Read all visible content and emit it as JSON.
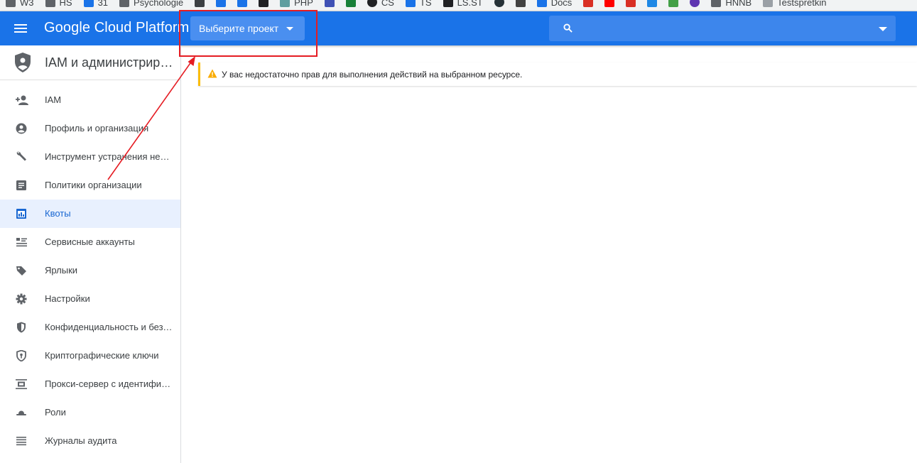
{
  "bookmarks": [
    {
      "label": "W3",
      "icon": "folder-icon",
      "color": "#5f6368"
    },
    {
      "label": "HS",
      "icon": "folder-icon",
      "color": "#5f6368"
    },
    {
      "label": "31",
      "icon": "calendar-icon",
      "color": "#1a73e8"
    },
    {
      "label": "Psychologie",
      "icon": "folder-icon",
      "color": "#5f6368"
    },
    {
      "label": "",
      "icon": "bookmark-icon",
      "color": "#3c4043"
    },
    {
      "label": "",
      "icon": "bookmark-icon",
      "color": "#1a73e8"
    },
    {
      "label": "",
      "icon": "bookmark-icon",
      "color": "#1a73e8"
    },
    {
      "label": "",
      "icon": "bookmark-icon",
      "color": "#202124"
    },
    {
      "label": "PHP",
      "icon": "bookmark-icon",
      "color": "#5f9ea0"
    },
    {
      "label": "",
      "icon": "bookmark-icon",
      "color": "#3f51b5"
    },
    {
      "label": "",
      "icon": "bookmark-icon",
      "color": "#188038"
    },
    {
      "label": "CS",
      "icon": "github-icon",
      "color": "#202124"
    },
    {
      "label": "TS",
      "icon": "bookmark-icon",
      "color": "#1a73e8"
    },
    {
      "label": "LS.ST",
      "icon": "bookmark-icon",
      "color": "#202124"
    },
    {
      "label": "",
      "icon": "bookmark-icon",
      "color": "#263238"
    },
    {
      "label": "",
      "icon": "bookmark-icon",
      "color": "#424242"
    },
    {
      "label": "Docs",
      "icon": "bookmark-icon",
      "color": "#1a73e8"
    },
    {
      "label": "",
      "icon": "bookmark-icon",
      "color": "#d93025"
    },
    {
      "label": "",
      "icon": "youtube-icon",
      "color": "#ff0000"
    },
    {
      "label": "",
      "icon": "bookmark-icon",
      "color": "#d93025"
    },
    {
      "label": "",
      "icon": "bookmark-icon",
      "color": "#1e88e5"
    },
    {
      "label": "",
      "icon": "bookmark-icon",
      "color": "#43a047"
    },
    {
      "label": "",
      "icon": "bookmark-icon",
      "color": "#5e35b1"
    },
    {
      "label": "HNNB",
      "icon": "folder-icon",
      "color": "#5f6368"
    },
    {
      "label": "Testspretkin",
      "icon": "bookmark-icon",
      "color": "#9aa0a6"
    }
  ],
  "header": {
    "brand": "Google Cloud Platform",
    "project_selector": "Выберите проект",
    "search_placeholder": ""
  },
  "sidebar": {
    "title": "IAM и администрирование",
    "items": [
      {
        "label": "IAM",
        "icon": "person-add-icon",
        "active": false
      },
      {
        "label": "Профиль и организация",
        "icon": "account-circle-icon",
        "active": false
      },
      {
        "label": "Инструмент устранения неполадок",
        "icon": "wrench-icon",
        "active": false
      },
      {
        "label": "Политики организации",
        "icon": "document-icon",
        "active": false
      },
      {
        "label": "Квоты",
        "icon": "quota-icon",
        "active": true
      },
      {
        "label": "Сервисные аккаунты",
        "icon": "service-account-icon",
        "active": false
      },
      {
        "label": "Ярлыки",
        "icon": "label-icon",
        "active": false
      },
      {
        "label": "Настройки",
        "icon": "gear-icon",
        "active": false
      },
      {
        "label": "Конфиденциальность и безопасность",
        "icon": "shield-icon",
        "active": false
      },
      {
        "label": "Криптографические ключи",
        "icon": "key-shield-icon",
        "active": false
      },
      {
        "label": "Прокси-сервер с идентификацией",
        "icon": "proxy-icon",
        "active": false
      },
      {
        "label": "Роли",
        "icon": "hat-icon",
        "active": false
      },
      {
        "label": "Журналы аудита",
        "icon": "list-icon",
        "active": false
      }
    ]
  },
  "warning": {
    "text": "У вас недостаточно прав для выполнения действий на выбранном ресурсе."
  },
  "colors": {
    "header_bg": "#1a73e8",
    "active_item_bg": "#e8f0fe",
    "active_item_text": "#1967d2",
    "warning_accent": "#fbbc04",
    "annotation": "#e51c23"
  }
}
